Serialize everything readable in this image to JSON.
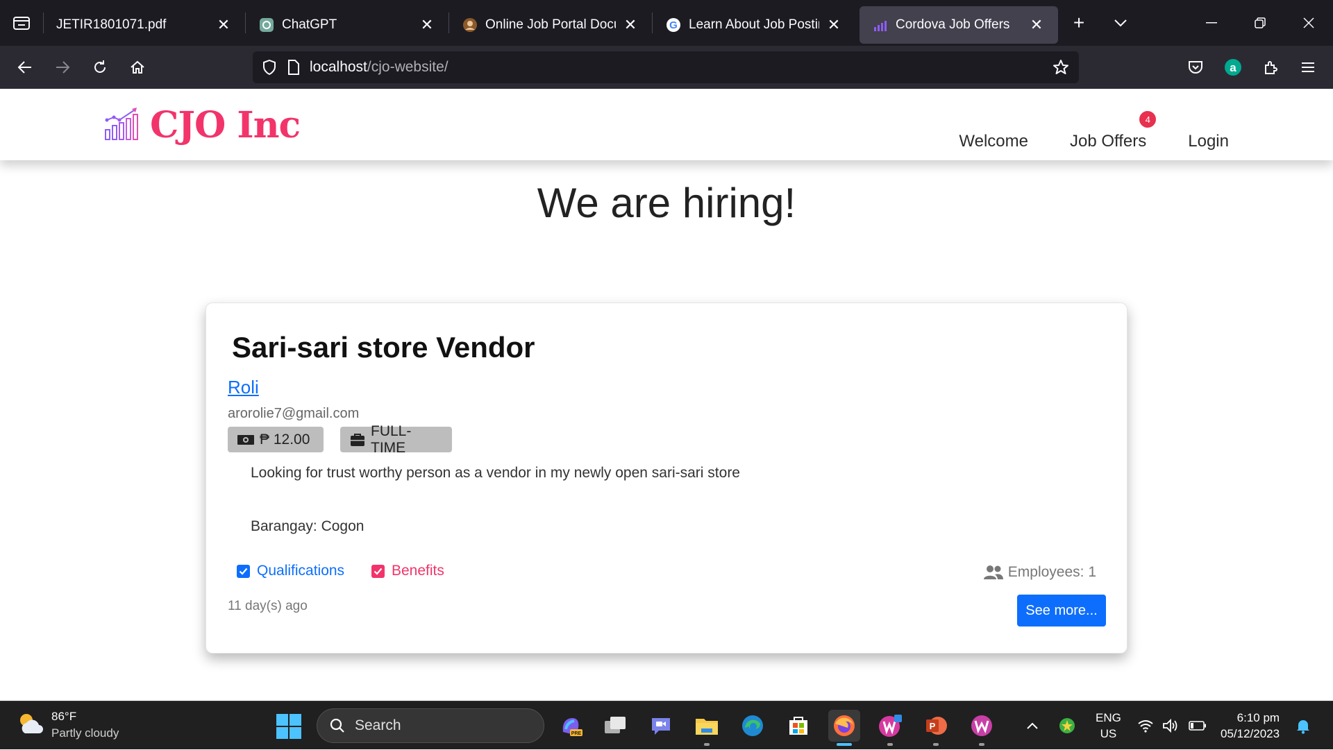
{
  "browser": {
    "tabs": [
      {
        "title": "JETIR1801071.pdf",
        "active": false
      },
      {
        "title": "ChatGPT",
        "active": false
      },
      {
        "title": "Online Job Portal Document",
        "active": false
      },
      {
        "title": "Learn About Job Posting S",
        "active": false
      },
      {
        "title": "Cordova Job Offers",
        "active": true
      }
    ],
    "url_host": "localhost",
    "url_path": "/cjo-website/"
  },
  "site": {
    "brand_name": "CJO Inc",
    "nav": {
      "welcome": "Welcome",
      "job_offers": "Job Offers",
      "job_offers_badge": "4",
      "login": "Login"
    },
    "hero_title": "We are hiring!"
  },
  "job": {
    "title": "Sari-sari store Vendor",
    "employer": "Roli",
    "email": "arorolie7@gmail.com",
    "salary": "₱ 12.00",
    "type": "FULL-TIME",
    "description": "Looking for trust worthy person as a vendor in my newly open sari-sari store",
    "location": "Barangay: Cogon",
    "qualifications_label": "Qualifications",
    "benefits_label": "Benefits",
    "employees": "Employees: 1",
    "posted": "11 day(s) ago",
    "see_more_label": "See more..."
  },
  "taskbar": {
    "weather_temp": "86°F",
    "weather_cond": "Partly cloudy",
    "search_label": "Search",
    "lang_top": "ENG",
    "lang_bottom": "US",
    "time": "6:10 pm",
    "date": "05/12/2023"
  },
  "colors": {
    "brand": "#f2346b",
    "primary": "#0d6efd",
    "badge": "#e8304f"
  }
}
